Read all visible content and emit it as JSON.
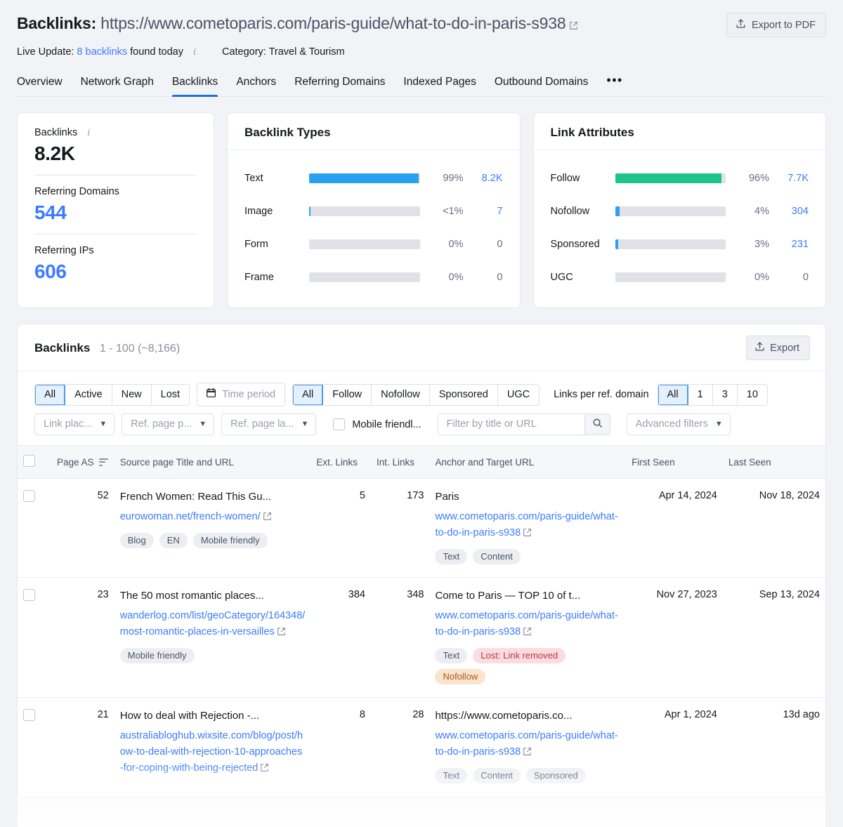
{
  "header": {
    "title_label": "Backlinks:",
    "title_url": "https://www.cometoparis.com/paris-guide/what-to-do-in-paris-s938",
    "export_pdf_label": "Export to PDF",
    "live_update_prefix": "Live Update:",
    "live_update_link": "8 backlinks",
    "live_update_suffix": "found today",
    "category_label": "Category: Travel & Tourism"
  },
  "tabs": {
    "items": [
      {
        "label": "Overview",
        "active": false
      },
      {
        "label": "Network Graph",
        "active": false
      },
      {
        "label": "Backlinks",
        "active": true
      },
      {
        "label": "Anchors",
        "active": false
      },
      {
        "label": "Referring Domains",
        "active": false
      },
      {
        "label": "Indexed Pages",
        "active": false
      },
      {
        "label": "Outbound Domains",
        "active": false
      }
    ],
    "more": "•••"
  },
  "summary": {
    "blocks": [
      {
        "label": "Backlinks",
        "value": "8.2K",
        "style": "dark",
        "info": true
      },
      {
        "label": "Referring Domains",
        "value": "544",
        "style": "blue",
        "info": false
      },
      {
        "label": "Referring IPs",
        "value": "606",
        "style": "blue",
        "info": false
      }
    ]
  },
  "chart_data": [
    {
      "type": "bar",
      "title": "Backlink Types",
      "orientation": "horizontal",
      "xlabel": "",
      "ylabel": "",
      "xlim": [
        0,
        100
      ],
      "grid": false,
      "legend": "none",
      "categories": [
        "Text",
        "Image",
        "Form",
        "Frame"
      ],
      "values": [
        99,
        0.5,
        0,
        0
      ],
      "pct_labels": [
        "99%",
        "<1%",
        "0%",
        "0%"
      ],
      "count_labels": [
        "8.2K",
        "7",
        "0",
        "0"
      ],
      "bar_color": "#28a2f0",
      "track_color": "#e0e2e8"
    },
    {
      "type": "bar",
      "title": "Link Attributes",
      "orientation": "horizontal",
      "xlabel": "",
      "ylabel": "",
      "xlim": [
        0,
        100
      ],
      "grid": false,
      "legend": "none",
      "categories": [
        "Follow",
        "Nofollow",
        "Sponsored",
        "UGC"
      ],
      "values": [
        96,
        4,
        3,
        0
      ],
      "pct_labels": [
        "96%",
        "4%",
        "3%",
        "0%"
      ],
      "count_labels": [
        "7.7K",
        "304",
        "231",
        "0"
      ],
      "bar_colors": [
        "#1ec28b",
        "#28a2f0",
        "#28a2f0",
        "#e0e2e8"
      ],
      "track_color": "#e0e2e8"
    }
  ],
  "panel": {
    "title": "Backlinks",
    "count": "1 - 100 (~8,166)",
    "export_label": "Export"
  },
  "filters": {
    "status": {
      "options": [
        "All",
        "Active",
        "New",
        "Lost"
      ],
      "selected": "All"
    },
    "time_period": {
      "label": "Time period"
    },
    "attribute": {
      "options": [
        "All",
        "Follow",
        "Nofollow",
        "Sponsored",
        "UGC"
      ],
      "selected": "All"
    },
    "links_per_domain": {
      "label": "Links per ref. domain",
      "options": [
        "All",
        "1",
        "3",
        "10"
      ],
      "selected": "All"
    },
    "dropdowns": [
      {
        "label": "Link plac..."
      },
      {
        "label": "Ref. page p..."
      },
      {
        "label": "Ref. page la..."
      }
    ],
    "mobile_friendly": {
      "label": "Mobile friendl...",
      "checked": false
    },
    "search": {
      "placeholder": "Filter by title or URL",
      "value": ""
    },
    "advanced": {
      "label": "Advanced filters"
    }
  },
  "table": {
    "columns": {
      "page_as": "Page AS",
      "source": "Source page Title and URL",
      "ext_links": "Ext. Links",
      "int_links": "Int. Links",
      "anchor": "Anchor and Target URL",
      "first_seen": "First Seen",
      "last_seen": "Last Seen"
    },
    "rows": [
      {
        "page_as": "52",
        "source_title": "French Women: Read This Gu...",
        "source_url": "eurowoman.net/french-women/",
        "source_tags": [
          {
            "text": "Blog",
            "style": "grey"
          },
          {
            "text": "EN",
            "style": "grey"
          },
          {
            "text": "Mobile friendly",
            "style": "grey"
          }
        ],
        "ext_links": "5",
        "int_links": "173",
        "anchor": "Paris",
        "target_url": "www.cometoparis.com/paris-guide/what-to-do-in-paris-s938",
        "anchor_tags": [
          {
            "text": "Text",
            "style": "grey"
          },
          {
            "text": "Content",
            "style": "grey"
          }
        ],
        "first_seen": "Apr 14, 2024",
        "last_seen": "Nov 18, 2024",
        "last_seen_lost": false
      },
      {
        "page_as": "23",
        "source_title": "The 50 most romantic places...",
        "source_url": "wanderlog.com/list/geoCategory/164348/most-romantic-places-in-versailles",
        "source_tags": [
          {
            "text": "Mobile friendly",
            "style": "grey"
          }
        ],
        "ext_links": "384",
        "int_links": "348",
        "anchor": "Come to Paris — TOP 10 of t...",
        "target_url": "www.cometoparis.com/paris-guide/what-to-do-in-paris-s938",
        "anchor_tags": [
          {
            "text": "Text",
            "style": "grey"
          },
          {
            "text": "Lost: Link removed",
            "style": "red"
          },
          {
            "text": "Nofollow",
            "style": "orange"
          }
        ],
        "first_seen": "Nov 27, 2023",
        "last_seen": "Sep 13, 2024",
        "last_seen_lost": true
      },
      {
        "page_as": "21",
        "source_title": "How to deal with Rejection -...",
        "source_url": "australiabloghub.wixsite.com/blog/post/how-to-deal-with-rejection-10-approaches-for-coping-with-being-rejected",
        "source_tags": [],
        "ext_links": "8",
        "int_links": "28",
        "anchor": "https://www.cometoparis.co...",
        "target_url": "www.cometoparis.com/paris-guide/what-to-do-in-paris-s938",
        "anchor_tags": [
          {
            "text": "Text",
            "style": "grey"
          },
          {
            "text": "Content",
            "style": "grey"
          },
          {
            "text": "Sponsored",
            "style": "grey"
          }
        ],
        "first_seen": "Apr 1, 2024",
        "last_seen": "13d ago",
        "last_seen_lost": false
      }
    ]
  }
}
